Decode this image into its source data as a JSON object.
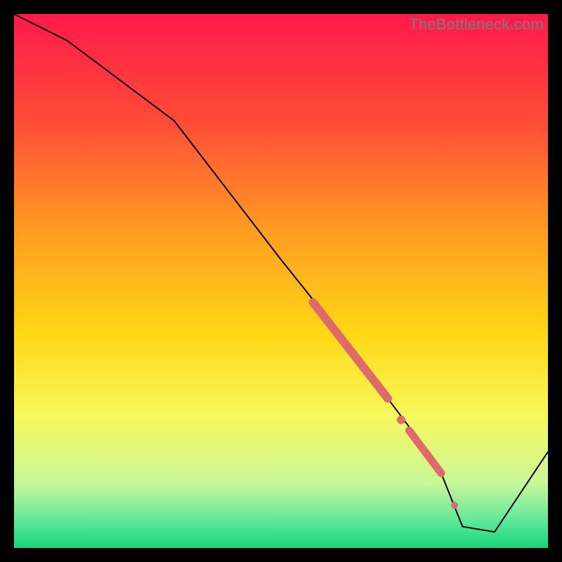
{
  "watermark": "TheBottleneck.com",
  "chart_data": {
    "type": "line",
    "title": "",
    "xlabel": "",
    "ylabel": "",
    "xlim": [
      0,
      100
    ],
    "ylim": [
      0,
      100
    ],
    "grid": false,
    "background_gradient": {
      "stops": [
        {
          "offset": 0.0,
          "color": "#ff1a4b"
        },
        {
          "offset": 0.2,
          "color": "#ff4b37"
        },
        {
          "offset": 0.4,
          "color": "#ff9a22"
        },
        {
          "offset": 0.6,
          "color": "#ffd814"
        },
        {
          "offset": 0.75,
          "color": "#f8f85a"
        },
        {
          "offset": 0.88,
          "color": "#c8f79a"
        },
        {
          "offset": 0.95,
          "color": "#5de89a"
        },
        {
          "offset": 1.0,
          "color": "#17d67a"
        }
      ]
    },
    "series": [
      {
        "name": "curve",
        "color": "#000000",
        "width": 2,
        "x": [
          0,
          10,
          22,
          30,
          40,
          50,
          58,
          64,
          70,
          76,
          80,
          84,
          90,
          100
        ],
        "y": [
          100,
          95,
          86,
          80,
          67,
          54,
          44,
          36,
          28,
          20,
          14,
          4,
          3,
          18
        ]
      }
    ],
    "markers": [
      {
        "name": "thick-red-segment",
        "type": "line",
        "color": "#e06a6a",
        "width": 12,
        "cap": "round",
        "x": [
          56,
          70
        ],
        "y": [
          46,
          28
        ]
      },
      {
        "name": "red-dot-mid",
        "type": "point",
        "color": "#e06a6a",
        "r": 6,
        "x": 72.5,
        "y": 24
      },
      {
        "name": "short-red-segment",
        "type": "line",
        "color": "#e06a6a",
        "width": 11,
        "cap": "round",
        "x": [
          74,
          80
        ],
        "y": [
          22,
          14
        ]
      },
      {
        "name": "red-dot-low",
        "type": "point",
        "color": "#e06a6a",
        "r": 5,
        "x": 82.5,
        "y": 8
      }
    ]
  }
}
